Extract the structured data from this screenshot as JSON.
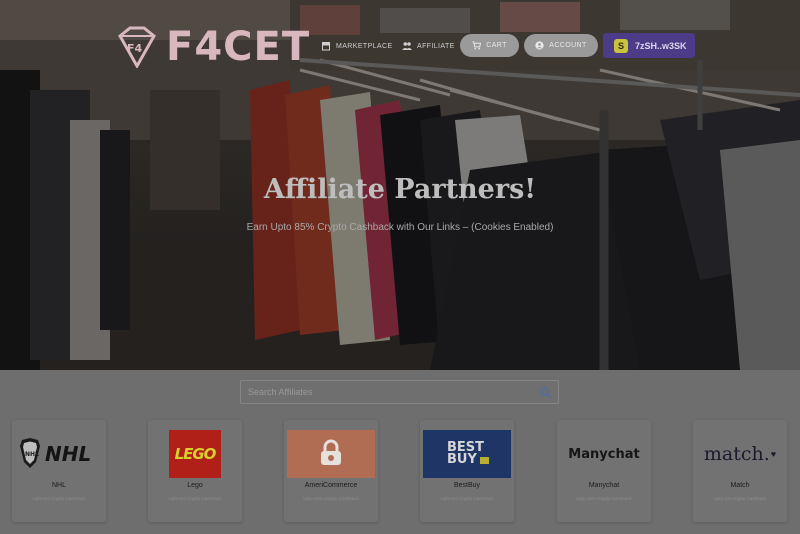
{
  "brand": {
    "name": "F4CET"
  },
  "nav": {
    "marketplace": "MARKETPLACE",
    "affiliate": "AFFILIATE",
    "cart": "CART",
    "account": "ACCOUNT",
    "wallet": "7zSH..w3SK"
  },
  "hero": {
    "title": "Affiliate Partners!",
    "subtitle": "Earn Upto 85% Crypto Cashback with Our Links – (Cookies Enabled)"
  },
  "search": {
    "placeholder": "Search Affiliates"
  },
  "affiliates": [
    {
      "name": "NHL",
      "logo_text": "NHL",
      "cashback": "Upto 4% Crypto Cashback"
    },
    {
      "name": "Lego",
      "logo_text": "LEGO",
      "cashback": "Upto 4% Crypto Cashback"
    },
    {
      "name": "AmeriCommerce",
      "logo_text": "",
      "cashback": "Upto 10% Crypto Cashback"
    },
    {
      "name": "BestBuy",
      "logo_text": "BEST BUY",
      "cashback": "Upto 1% Crypto Cashback"
    },
    {
      "name": "Manychat",
      "logo_text": "Manychat",
      "cashback": "Upto 10% Crypto Cashback"
    },
    {
      "name": "Match",
      "logo_text": "match.",
      "cashback": "Upto 1% Crypto Cashback"
    }
  ],
  "colors": {
    "wallet_bg": "#4c3b86",
    "logo_pink": "#d9b7bf",
    "lego_red": "#c8241c",
    "bestbuy_blue": "#1f3f86",
    "americommerce_orange": "#e08a68"
  }
}
